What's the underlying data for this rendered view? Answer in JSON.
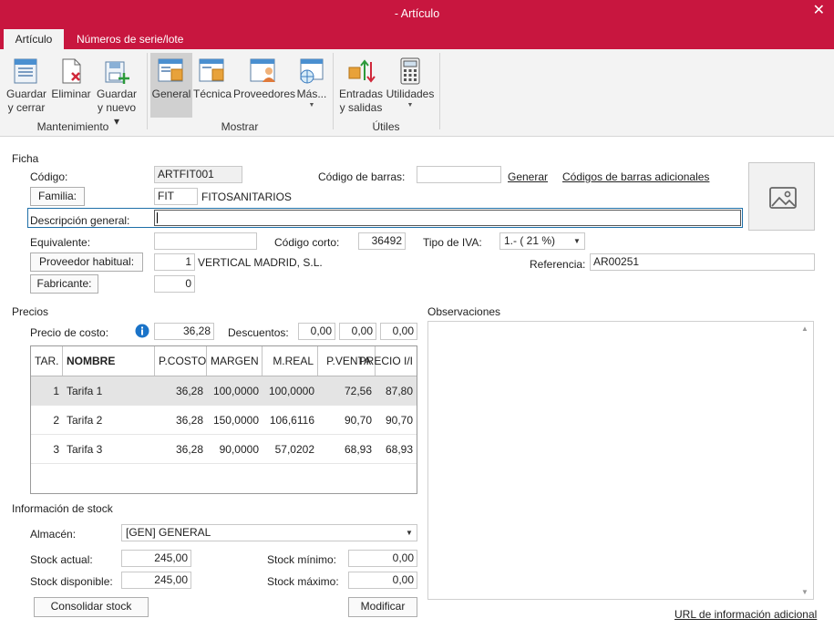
{
  "window": {
    "title": "- Artículo",
    "close": "✕"
  },
  "tabs": [
    "Artículo",
    "Números de serie/lote"
  ],
  "ribbon": {
    "groups": {
      "mantenimiento": "Mantenimiento",
      "mostrar": "Mostrar",
      "utiles": "Útiles"
    },
    "buttons": {
      "guardar_cerrar": {
        "l1": "Guardar",
        "l2": "y cerrar"
      },
      "eliminar": "Eliminar",
      "guardar_nuevo": {
        "l1": "Guardar",
        "l2": "y nuevo ▾"
      },
      "general": "General",
      "tecnica": "Técnica",
      "proveedores": "Proveedores",
      "mas": "Más...",
      "entradas": {
        "l1": "Entradas",
        "l2": "y salidas"
      },
      "utilidades": "Utilidades"
    }
  },
  "ficha": {
    "section": "Ficha",
    "codigo_label": "Código:",
    "codigo_value": "ARTFIT001",
    "codigo_barras_label": "Código de barras:",
    "codigo_barras_value": "",
    "generar": "Generar",
    "codigos_adicionales": "Códigos de barras adicionales",
    "familia_button": "Familia:",
    "familia_code": "FIT",
    "familia_name": "FITOSANITARIOS",
    "descripcion_label": "Descripción general:",
    "descripcion_value": "",
    "equivalente_label": "Equivalente:",
    "equivalente_value": "",
    "codigo_corto_label": "Código corto:",
    "codigo_corto_value": "36492",
    "tipo_iva_label": "Tipo de IVA:",
    "tipo_iva_value": "1.- ( 21 %)",
    "proveedor_button": "Proveedor habitual:",
    "proveedor_code": "1",
    "proveedor_name": "VERTICAL MADRID, S.L.",
    "referencia_label": "Referencia:",
    "referencia_value": "AR00251",
    "fabricante_button": "Fabricante:",
    "fabricante_value": "0"
  },
  "precios": {
    "section": "Precios",
    "precio_costo_label": "Precio de costo:",
    "precio_costo_value": "36,28",
    "descuentos_label": "Descuentos:",
    "descuentos": [
      "0,00",
      "0,00",
      "0,00"
    ],
    "headers": [
      "TAR.",
      "NOMBRE",
      "P.COSTO",
      "MARGEN",
      "M.REAL",
      "P.VENTA",
      "PRECIO I/I"
    ],
    "rows": [
      [
        "1",
        "Tarifa 1",
        "36,28",
        "100,0000",
        "100,0000",
        "72,56",
        "87,80"
      ],
      [
        "2",
        "Tarifa 2",
        "36,28",
        "150,0000",
        "106,6116",
        "90,70",
        "90,70"
      ],
      [
        "3",
        "Tarifa 3",
        "36,28",
        "90,0000",
        "57,0202",
        "68,93",
        "68,93"
      ]
    ]
  },
  "observaciones": {
    "section": "Observaciones",
    "url_link": "URL de información adicional"
  },
  "stock": {
    "section": "Información de stock",
    "almacen_label": "Almacén:",
    "almacen_value": "[GEN] GENERAL",
    "actual_label": "Stock actual:",
    "actual_value": "245,00",
    "disponible_label": "Stock disponible:",
    "disponible_value": "245,00",
    "minimo_label": "Stock mínimo:",
    "minimo_value": "0,00",
    "maximo_label": "Stock máximo:",
    "maximo_value": "0,00",
    "consolidar": "Consolidar stock",
    "modificar": "Modificar"
  },
  "colors": {
    "accent": "#c8163f",
    "focus_border": "#1e6fa8",
    "info_icon": "#1a73c8"
  }
}
